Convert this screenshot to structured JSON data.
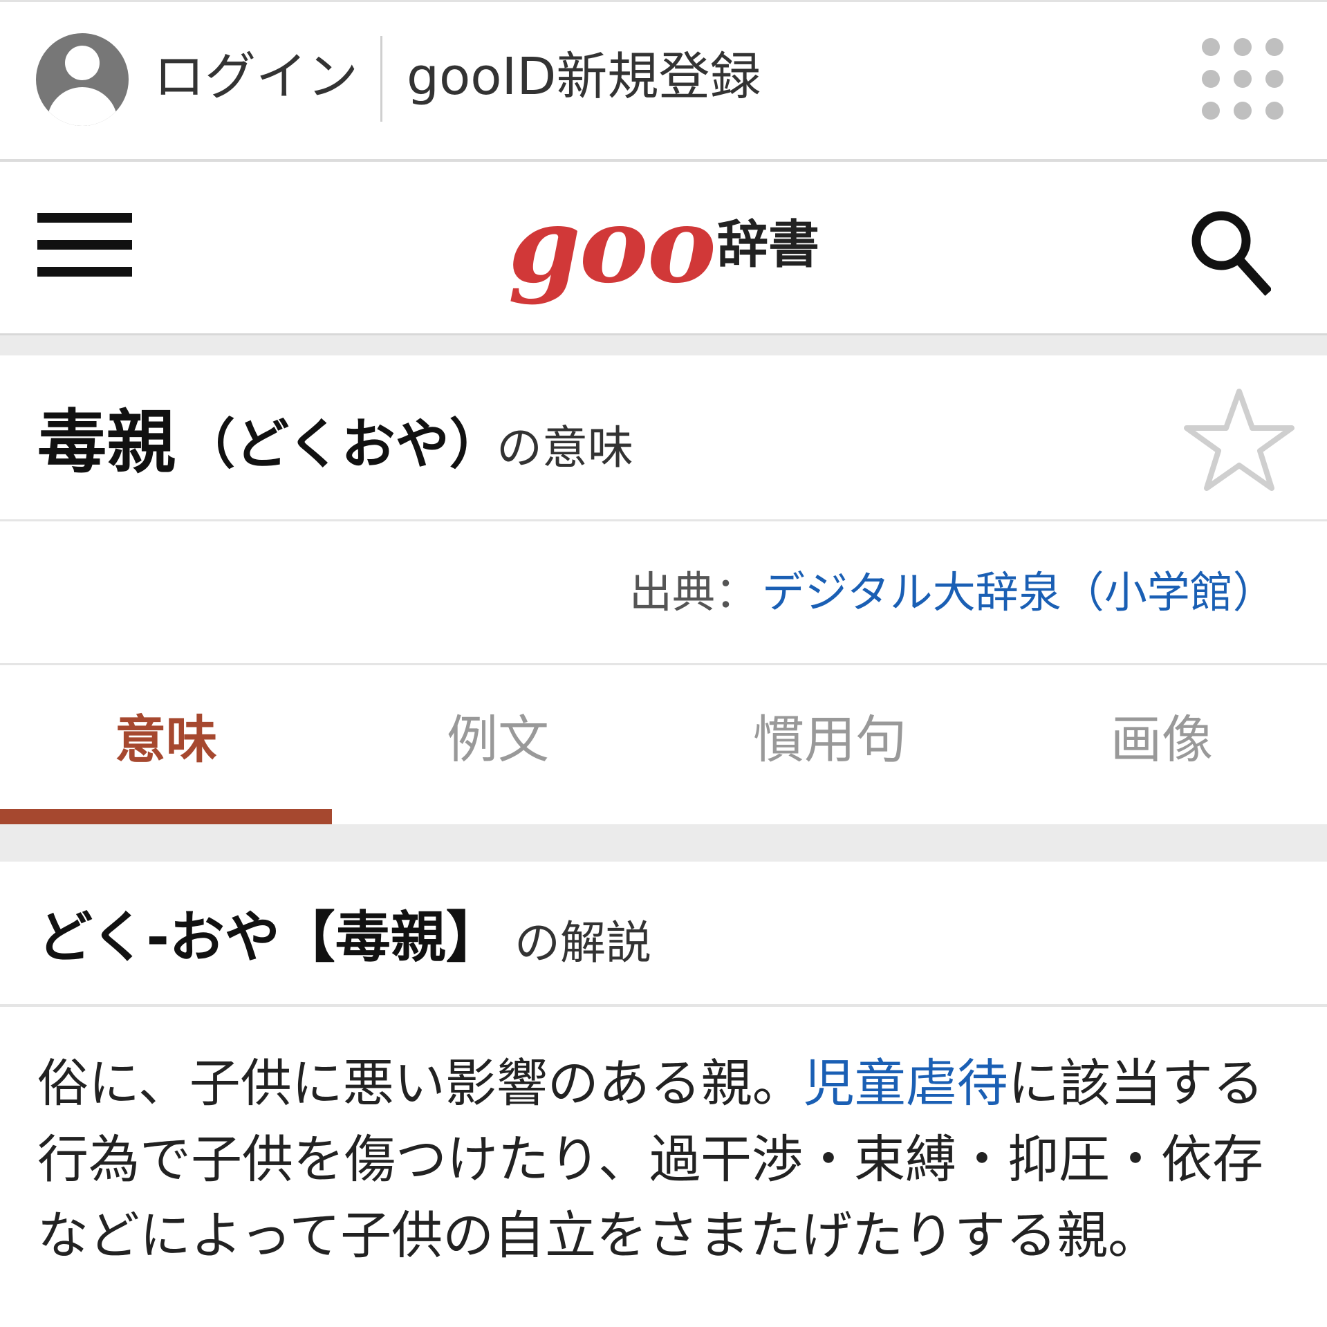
{
  "account": {
    "login_label": "ログイン",
    "register_label": "gooID新規登録"
  },
  "header": {
    "logo_main": "goo",
    "logo_sub": "辞書"
  },
  "entry": {
    "word": "毒親",
    "reading": "（どくおや）",
    "meaning_suffix": "の意味"
  },
  "source": {
    "prefix": "出典：",
    "name": "デジタル大辞泉（小学館）"
  },
  "tabs": [
    {
      "label": "意味",
      "active": true
    },
    {
      "label": "例文",
      "active": false
    },
    {
      "label": "慣用句",
      "active": false
    },
    {
      "label": "画像",
      "active": false
    }
  ],
  "explanation": {
    "title": "どく-おや【毒親】",
    "suffix": "の解説",
    "line1_a": "俗に、子供に悪い影響のある親。",
    "line1_link": "児童虐待",
    "line1_b": "に該当する",
    "line2": "行為で子供を傷つけたり、過干渉・束縛・抑圧・依存",
    "line3": "などによって子供の自立をさまたげたりする親。"
  },
  "colors": {
    "brand_red": "#d13838",
    "tab_active": "#a6482f",
    "link_blue": "#1a5fb4"
  },
  "icons": [
    "user-avatar-icon",
    "apps-grid-icon",
    "hamburger-menu-icon",
    "search-icon",
    "star-icon"
  ]
}
